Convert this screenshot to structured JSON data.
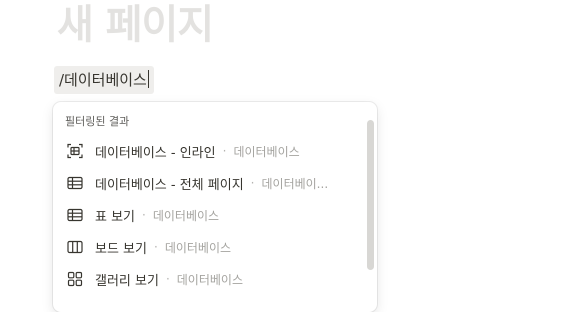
{
  "page": {
    "title": "새 페이지"
  },
  "slash_input": {
    "value": "/데이터베이스"
  },
  "menu": {
    "header": "필터링된 결과",
    "separator": "·",
    "items": [
      {
        "label": "데이터베이스 - 인라인",
        "sublabel": "데이터베이스",
        "icon": "database-inline-icon"
      },
      {
        "label": "데이터베이스 - 전체 페이지",
        "sublabel": "데이터베이...",
        "icon": "table-icon"
      },
      {
        "label": "표 보기",
        "sublabel": "데이터베이스",
        "icon": "table-icon"
      },
      {
        "label": "보드 보기",
        "sublabel": "데이터베이스",
        "icon": "board-icon"
      },
      {
        "label": "갤러리 보기",
        "sublabel": "데이터베이스",
        "icon": "gallery-icon"
      }
    ]
  },
  "colors": {
    "text": "#37352f",
    "muted": "#a5a4a0",
    "title_placeholder": "#e3e2e0",
    "input_bg": "#efeeec"
  }
}
